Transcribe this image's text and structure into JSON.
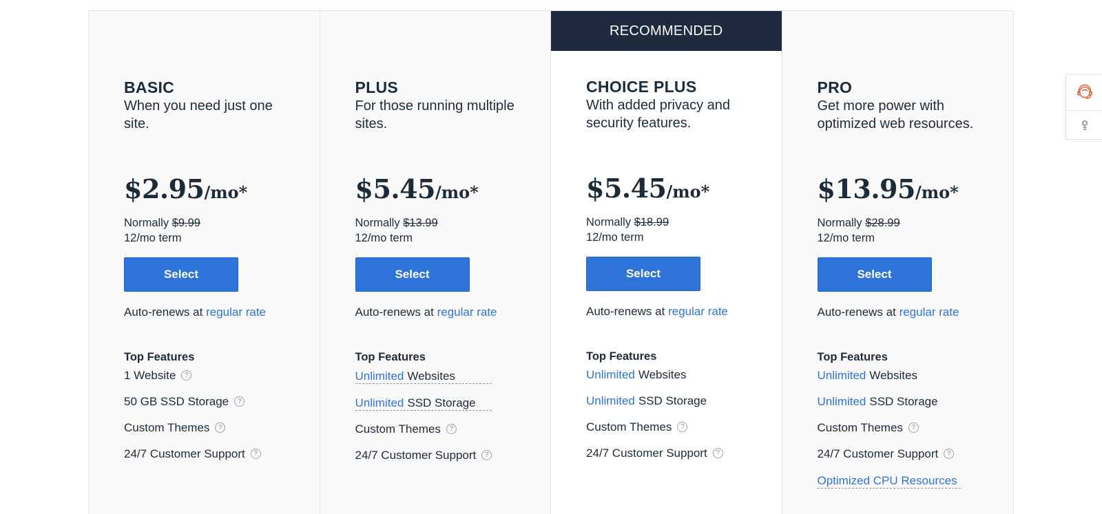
{
  "recommended_label": "RECOMMENDED",
  "plans": [
    {
      "name": "BASIC",
      "desc": "When you need just one site.",
      "price": "$2.95",
      "per": "/mo*",
      "normally_label": "Normally",
      "normal_price": "$9.99",
      "term": "12/mo term",
      "select_label": "Select",
      "autorenew_text": "Auto-renews at",
      "autorenew_link": "regular rate",
      "features_title": "Top Features",
      "features": [
        {
          "highlight": "",
          "text": "1 Website"
        },
        {
          "highlight": "",
          "text": "50 GB SSD Storage"
        },
        {
          "highlight": "",
          "text": "Custom Themes"
        },
        {
          "highlight": "",
          "text": "24/7 Customer Support"
        }
      ]
    },
    {
      "name": "PLUS",
      "desc": "For those running multiple sites.",
      "price": "$5.45",
      "per": "/mo*",
      "normally_label": "Normally",
      "normal_price": "$13.99",
      "term": "12/mo term",
      "select_label": "Select",
      "autorenew_text": "Auto-renews at",
      "autorenew_link": "regular rate",
      "features_title": "Top Features",
      "features": [
        {
          "highlight": "Unlimited",
          "text": "Websites"
        },
        {
          "highlight": "Unlimited",
          "text": "SSD Storage"
        },
        {
          "highlight": "",
          "text": "Custom Themes"
        },
        {
          "highlight": "",
          "text": "24/7 Customer Support"
        }
      ]
    },
    {
      "name": "CHOICE PLUS",
      "desc": "With added privacy and security features.",
      "price": "$5.45",
      "per": "/mo*",
      "normally_label": "Normally",
      "normal_price": "$18.99",
      "term": "12/mo term",
      "select_label": "Select",
      "autorenew_text": "Auto-renews at",
      "autorenew_link": "regular rate",
      "features_title": "Top Features",
      "features": [
        {
          "highlight": "Unlimited",
          "text": "Websites"
        },
        {
          "highlight": "Unlimited",
          "text": "SSD Storage"
        },
        {
          "highlight": "",
          "text": "Custom Themes"
        },
        {
          "highlight": "",
          "text": "24/7 Customer Support"
        }
      ]
    },
    {
      "name": "PRO",
      "desc": "Get more power with optimized web resources.",
      "price": "$13.95",
      "per": "/mo*",
      "normally_label": "Normally",
      "normal_price": "$28.99",
      "term": "12/mo term",
      "select_label": "Select",
      "autorenew_text": "Auto-renews at",
      "autorenew_link": "regular rate",
      "features_title": "Top Features",
      "features": [
        {
          "highlight": "Unlimited",
          "text": "Websites"
        },
        {
          "highlight": "Unlimited",
          "text": "SSD Storage"
        },
        {
          "highlight": "",
          "text": "Custom Themes"
        },
        {
          "highlight": "",
          "text": "24/7 Customer Support"
        },
        {
          "highlight": "Optimized CPU Resources",
          "text": ""
        }
      ]
    }
  ],
  "icons": {
    "help": "?",
    "chat": "chat-agent-icon",
    "other": "lightbulb-icon"
  },
  "colors": {
    "accent": "#2e73d9",
    "banner": "#1e2b3e",
    "text": "#1c2b3a",
    "chat_icon": "#e8663d"
  }
}
